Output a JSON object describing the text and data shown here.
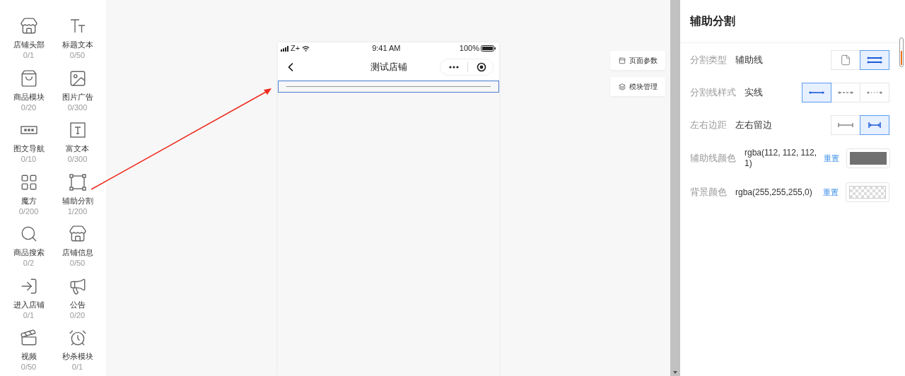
{
  "components": [
    {
      "label": "店铺头部",
      "count": "0/1"
    },
    {
      "label": "标题文本",
      "count": "0/50"
    },
    {
      "label": "商品模块",
      "count": "0/20"
    },
    {
      "label": "图片广告",
      "count": "0/300"
    },
    {
      "label": "图文导航",
      "count": "0/10"
    },
    {
      "label": "富文本",
      "count": "0/300"
    },
    {
      "label": "魔方",
      "count": "0/200"
    },
    {
      "label": "辅助分割",
      "count": "1/200"
    },
    {
      "label": "商品搜索",
      "count": "0/2"
    },
    {
      "label": "店铺信息",
      "count": "0/50"
    },
    {
      "label": "进入店铺",
      "count": "0/1"
    },
    {
      "label": "公告",
      "count": "0/20"
    },
    {
      "label": "视频",
      "count": "0/50"
    },
    {
      "label": "秒杀模块",
      "count": "0/1"
    }
  ],
  "phone": {
    "carrier": "Z+",
    "time": "9:41 AM",
    "battery": "100%",
    "title": "测试店铺",
    "divider_selected": true
  },
  "side_buttons": [
    "页面参数",
    "模块管理"
  ],
  "panel": {
    "title": "辅助分割",
    "rows": [
      {
        "kind": "segmented",
        "label": "分割类型",
        "value": "辅助线",
        "options": [
          {
            "selected": false
          },
          {
            "selected": true
          }
        ]
      },
      {
        "kind": "segmented",
        "label": "分割线样式",
        "value": "实线",
        "options": [
          {
            "selected": true
          },
          {
            "selected": false
          },
          {
            "selected": false
          }
        ]
      },
      {
        "kind": "segmented",
        "label": "左右边距",
        "value": "左右留边",
        "options": [
          {
            "selected": false
          },
          {
            "selected": true
          }
        ]
      },
      {
        "kind": "color",
        "label": "辅助线颜色",
        "value": "rgba(112, 112, 112, 1)",
        "reset": "重置",
        "transparent": false,
        "color": "#707070"
      },
      {
        "kind": "color",
        "label": "背景颜色",
        "value": "rgba(255,255,255,0)",
        "reset": "重置",
        "transparent": true
      }
    ]
  }
}
